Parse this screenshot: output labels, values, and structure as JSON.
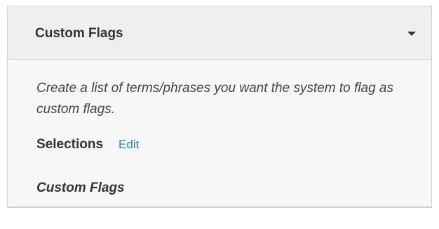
{
  "panel": {
    "title": "Custom Flags",
    "toggle_icon": "caret-down-icon",
    "description": "Create a list of terms/phrases you want the system to flag as custom flags.",
    "selections_label": "Selections",
    "edit_label": "Edit",
    "selection_value": "Custom Flags"
  },
  "colors": {
    "header_bg": "#efefef",
    "body_bg": "#f7f7f7",
    "link": "#2a7fc0",
    "text": "#333333"
  }
}
